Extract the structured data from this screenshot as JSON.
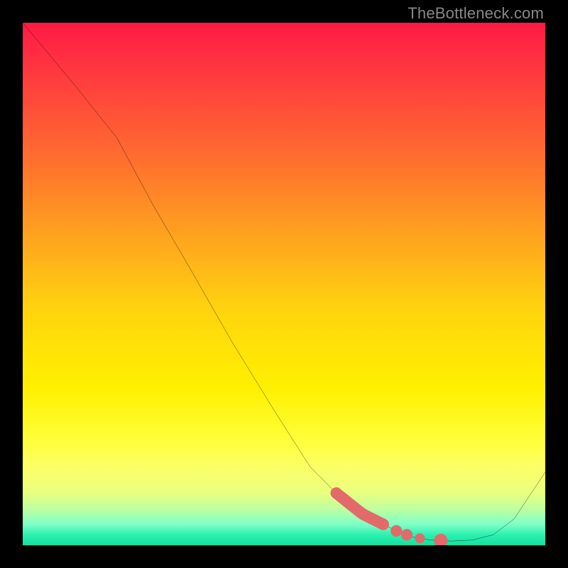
{
  "watermark": "TheBottleneck.com",
  "colors": {
    "background": "#000000",
    "curve": "#000000",
    "marker": "#e26a6a"
  },
  "chart_data": {
    "type": "line",
    "title": "",
    "xlabel": "",
    "ylabel": "",
    "xlim": [
      0,
      100
    ],
    "ylim": [
      0,
      100
    ],
    "grid": false,
    "legend": false,
    "series": [
      {
        "name": "bottleneck-curve",
        "x": [
          0,
          5,
          10,
          18,
          25,
          32,
          40,
          48,
          55,
          60,
          65,
          69,
          72,
          75,
          78,
          82,
          86,
          90,
          94,
          100
        ],
        "y": [
          100,
          94,
          88,
          78,
          65,
          53,
          39,
          26,
          15,
          10,
          6,
          4,
          2.5,
          1.5,
          1,
          0.8,
          1,
          2,
          5,
          14
        ]
      }
    ],
    "highlight_band": {
      "x_start": 60,
      "x_end": 69,
      "width": 2.2
    },
    "highlight_dots": [
      {
        "x": 71.5,
        "r": 1.1
      },
      {
        "x": 73.5,
        "r": 1.1
      },
      {
        "x": 76,
        "r": 0.95
      },
      {
        "x": 80,
        "r": 1.3
      }
    ]
  }
}
